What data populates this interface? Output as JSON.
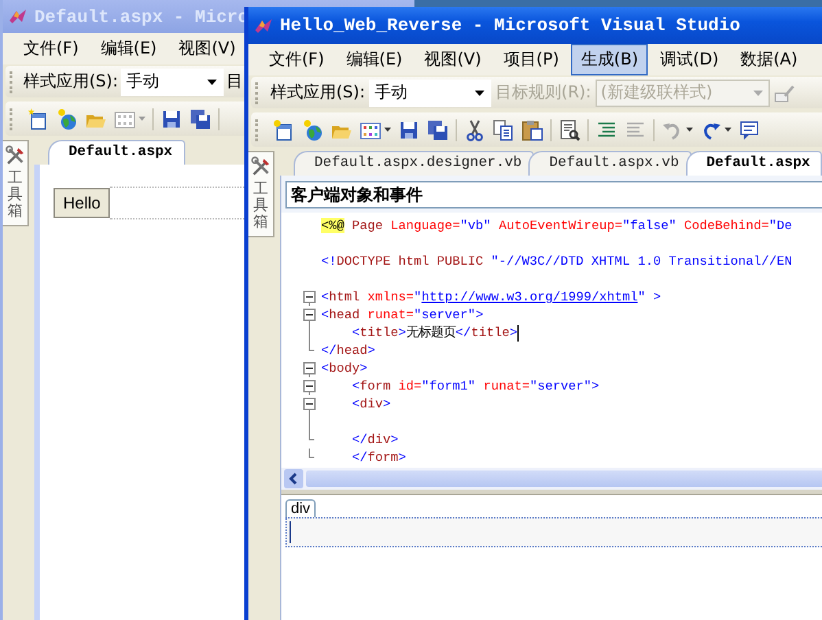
{
  "back_window": {
    "title": "Default.aspx - Micro",
    "menu": [
      {
        "label": "文件(F)",
        "selected": false
      },
      {
        "label": "编辑(E)",
        "selected": false
      },
      {
        "label": "视图(V)",
        "selected": false
      }
    ],
    "style_toolbar": {
      "label": "样式应用(S):",
      "value": "手动",
      "next_label": "目"
    },
    "toolbox_tab": "工具箱",
    "tabs": [
      {
        "label": "Default.aspx",
        "selected": true
      }
    ],
    "design": {
      "button": "Hello"
    }
  },
  "front_window": {
    "title": "Hello_Web_Reverse - Microsoft Visual Studio",
    "menu": [
      {
        "label": "文件(F)",
        "selected": false
      },
      {
        "label": "编辑(E)",
        "selected": false
      },
      {
        "label": "视图(V)",
        "selected": false
      },
      {
        "label": "项目(P)",
        "selected": false
      },
      {
        "label": "生成(B)",
        "selected": true
      },
      {
        "label": "调试(D)",
        "selected": false
      },
      {
        "label": "数据(A)",
        "selected": false
      }
    ],
    "style_toolbar": {
      "label": "样式应用(S):",
      "value": "手动",
      "target_label": "目标规则(R):",
      "target_value": "(新建级联样式)",
      "disabled": true
    },
    "toolbox_tab": "工具箱",
    "tabs": [
      {
        "label": "Default.aspx.designer.vb",
        "selected": false
      },
      {
        "label": "Default.aspx.vb",
        "selected": false
      },
      {
        "label": "Default.aspx",
        "selected": true
      }
    ],
    "object_dropdown": "客户端对象和事件",
    "code_lines": [
      {
        "kind": "plain",
        "tokens": [
          {
            "kind": "directive",
            "text": "<%@"
          },
          {
            "kind": "tag",
            "text": " Page"
          },
          {
            "kind": "attr",
            "text": " Language="
          },
          {
            "kind": "value",
            "text": "\"vb\""
          },
          {
            "kind": "attr",
            "text": " AutoEventWireup="
          },
          {
            "kind": "value",
            "text": "\"false\""
          },
          {
            "kind": "attr",
            "text": " CodeBehind="
          },
          {
            "kind": "value",
            "text": "\"De"
          }
        ]
      },
      {
        "kind": "plain"
      },
      {
        "kind": "plain",
        "tokens": [
          {
            "kind": "bracket",
            "text": "<!"
          },
          {
            "kind": "tag",
            "text": "DOCTYPE html PUBLIC"
          },
          {
            "kind": "value",
            "text": " \"-//W3C//DTD XHTML 1.0 Transitional//EN"
          }
        ]
      },
      {
        "kind": "plain"
      },
      {
        "kind": "open",
        "tokens": [
          {
            "kind": "bracket",
            "text": "<"
          },
          {
            "kind": "tag",
            "text": "html"
          },
          {
            "kind": "attr",
            "text": " xmlns="
          },
          {
            "kind": "value",
            "text": "\""
          },
          {
            "kind": "link",
            "text": "http://www.w3.org/1999/xhtml"
          },
          {
            "kind": "value",
            "text": "\" "
          },
          {
            "kind": "bracket",
            "text": ">"
          }
        ]
      },
      {
        "kind": "open",
        "tokens": [
          {
            "kind": "bracket",
            "text": "<"
          },
          {
            "kind": "tag",
            "text": "head"
          },
          {
            "kind": "attr",
            "text": " runat="
          },
          {
            "kind": "value",
            "text": "\"server\""
          },
          {
            "kind": "bracket",
            "text": ">"
          }
        ]
      },
      {
        "kind": "guide",
        "caret": true,
        "tokens": [
          {
            "kind": "bracket",
            "text": "    <"
          },
          {
            "kind": "tag",
            "text": "title"
          },
          {
            "kind": "bracket",
            "text": ">"
          },
          {
            "kind": "text",
            "text": "无标题页"
          },
          {
            "kind": "bracket",
            "text": "</"
          },
          {
            "kind": "tag",
            "text": "title"
          },
          {
            "kind": "bracket",
            "text": ">"
          }
        ]
      },
      {
        "kind": "end",
        "tokens": [
          {
            "kind": "bracket",
            "text": "</"
          },
          {
            "kind": "tag",
            "text": "head"
          },
          {
            "kind": "bracket",
            "text": ">"
          }
        ]
      },
      {
        "kind": "open",
        "tokens": [
          {
            "kind": "bracket",
            "text": "<"
          },
          {
            "kind": "tag",
            "text": "body"
          },
          {
            "kind": "bracket",
            "text": ">"
          }
        ]
      },
      {
        "kind": "open",
        "tokens": [
          {
            "kind": "bracket",
            "text": "    <"
          },
          {
            "kind": "tag",
            "text": "form"
          },
          {
            "kind": "attr",
            "text": " id="
          },
          {
            "kind": "value",
            "text": "\"form1\""
          },
          {
            "kind": "attr",
            "text": " runat="
          },
          {
            "kind": "value",
            "text": "\"server\""
          },
          {
            "kind": "bracket",
            "text": ">"
          }
        ]
      },
      {
        "kind": "open",
        "tokens": [
          {
            "kind": "bracket",
            "text": "    <"
          },
          {
            "kind": "tag",
            "text": "div"
          },
          {
            "kind": "bracket",
            "text": ">"
          }
        ]
      },
      {
        "kind": "guide"
      },
      {
        "kind": "end",
        "tokens": [
          {
            "kind": "bracket",
            "text": "    </"
          },
          {
            "kind": "tag",
            "text": "div"
          },
          {
            "kind": "bracket",
            "text": ">"
          }
        ]
      },
      {
        "kind": "end",
        "tokens": [
          {
            "kind": "bracket",
            "text": "    </"
          },
          {
            "kind": "tag",
            "text": "form"
          },
          {
            "kind": "bracket",
            "text": ">"
          }
        ]
      }
    ],
    "design_tag": "div"
  }
}
